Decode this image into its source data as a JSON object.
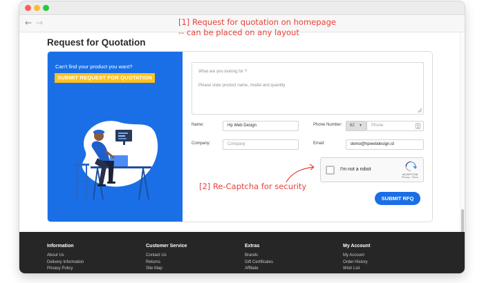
{
  "browser": {
    "back_icon": "←",
    "forward_icon": "→"
  },
  "annotations": {
    "note1_line1": "[1] Request for quotation on homepage",
    "note1_line2": "-- can be placed on any layout",
    "note2": "[2] Re-Captcha for security"
  },
  "page": {
    "title": "Request for Quotation"
  },
  "rfq": {
    "left_prompt": "Can't find your product you want?",
    "submit_request_label": "SUBMIT REQUEST FOR QUOTATION",
    "textarea_placeholder_line1": "What are you looking for ?",
    "textarea_placeholder_line2": "Please state product name, model and quantity",
    "name_label": "Name:",
    "name_value": "Hp Web Design",
    "company_label": "Company:",
    "company_placeholder": "Company",
    "phone_label": "Phone Number:",
    "phone_country_code": "62",
    "phone_placeholder": "Phone",
    "email_label": "Email:",
    "email_value": "demo@hpwebdesign.id",
    "captcha_label": "I'm not a robot",
    "captcha_brand": "reCAPTCHA",
    "captcha_links": "Privacy - Terms",
    "submit_rfq_label": "SUBMIT RFQ"
  },
  "footer": {
    "columns": [
      {
        "heading": "Information",
        "links": [
          "About Us",
          "Delivery Information",
          "Privacy Policy"
        ]
      },
      {
        "heading": "Customer Service",
        "links": [
          "Contact Us",
          "Returns",
          "Site Map"
        ]
      },
      {
        "heading": "Extras",
        "links": [
          "Brands",
          "Gift Certificates",
          "Affiliate"
        ]
      },
      {
        "heading": "My Account",
        "links": [
          "My Account",
          "Order History",
          "Wish List"
        ]
      }
    ]
  },
  "colors": {
    "primary_blue": "#1a6fe6",
    "accent_yellow": "#ffc21f",
    "annotation_red": "#e8423a",
    "footer_bg": "#262626"
  }
}
